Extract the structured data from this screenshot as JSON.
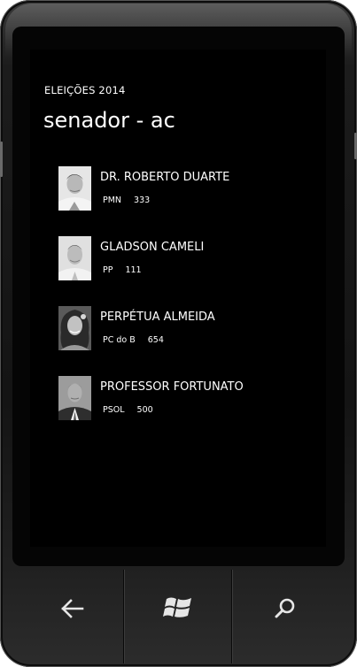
{
  "app": {
    "title": "ELEIÇÕES 2014",
    "page_title": "senador - ac"
  },
  "candidates": [
    {
      "name": "DR. ROBERTO DUARTE",
      "party": "PMN",
      "number": "333"
    },
    {
      "name": "GLADSON CAMELI",
      "party": "PP",
      "number": "111"
    },
    {
      "name": "PERPÉTUA ALMEIDA",
      "party": "PC do B",
      "number": "654"
    },
    {
      "name": "PROFESSOR FORTUNATO",
      "party": "PSOL",
      "number": "500"
    }
  ],
  "nav": {
    "back_icon": "back-arrow-icon",
    "start_icon": "windows-logo-icon",
    "search_icon": "search-icon"
  },
  "colors": {
    "screen_background": "#000000",
    "text": "#ffffff",
    "frame": "#1c1c1c"
  }
}
